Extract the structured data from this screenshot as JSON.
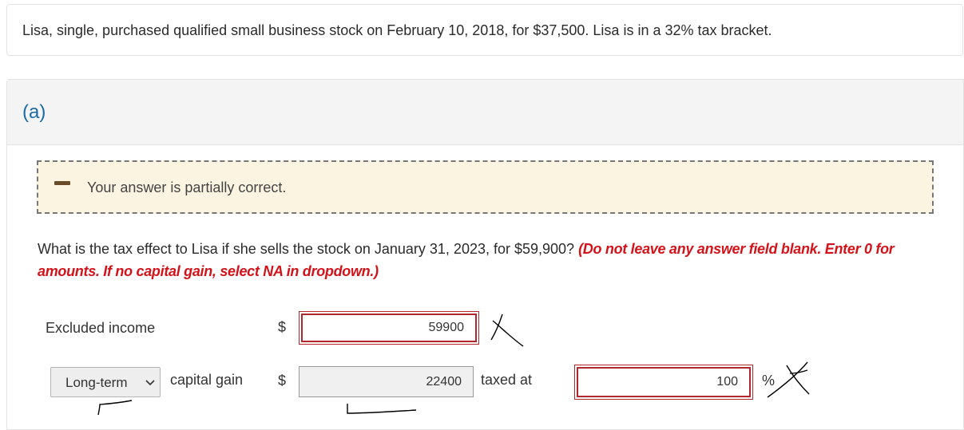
{
  "problem": {
    "text": "Lisa, single, purchased qualified small business stock on February 10, 2018, for $37,500. Lisa is in a 32% tax bracket."
  },
  "part": {
    "label": "(a)",
    "feedback": "Your answer is partially correct.",
    "question": "What is the tax effect to Lisa if she sells the stock on January 31, 2023, for $59,900?",
    "instruction": "(Do not leave any answer field blank. Enter 0 for amounts. If no capital gain, select NA in dropdown.)"
  },
  "rows": {
    "excluded": {
      "label": "Excluded income",
      "currency": "$",
      "value": "59900",
      "status": "incorrect"
    },
    "gain": {
      "select_value": "Long-term",
      "label": "capital gain",
      "currency": "$",
      "value": "22400",
      "status": "correct",
      "taxed_at_label": "taxed at",
      "rate_value": "100",
      "rate_unit": "%",
      "rate_status": "incorrect"
    }
  },
  "colors": {
    "accent": "#1a6aa5",
    "incorrect": "#b0282c",
    "instruction": "#d3131a",
    "feedback_bg": "#fbf4e1"
  }
}
